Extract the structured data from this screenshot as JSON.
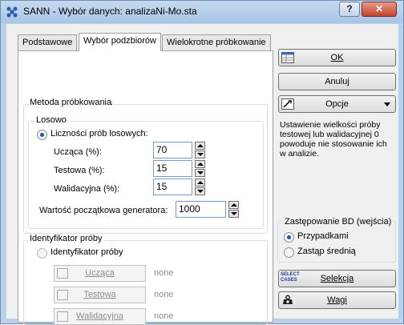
{
  "window": {
    "title": "SANN - Wybór danych: analizaNi-Mo.sta",
    "help": "?",
    "close": "✕"
  },
  "tabs": [
    "Podstawowe",
    "Wybór podzbiorów",
    "Wielokrotne próbkowanie"
  ],
  "method": {
    "group_label": "Metoda próbkowania",
    "random": {
      "group_label": "Losowo",
      "option_label": "Liczności prób losowych:",
      "fields": [
        {
          "label": "Ucząca (%):",
          "value": "70"
        },
        {
          "label": "Testowa (%):",
          "value": "15"
        },
        {
          "label": "Walidacyjna (%):",
          "value": "15"
        }
      ],
      "seed_label": "Wartość początkowa generatora:",
      "seed_value": "1000"
    },
    "identifier": {
      "group_label": "Identyfikator próby",
      "option_label": "Identyfikator próby",
      "buttons": [
        {
          "label": "Ucząca",
          "status": "none"
        },
        {
          "label": "Testowa",
          "status": "none"
        },
        {
          "label": "Walidacyjna",
          "status": "none"
        }
      ]
    }
  },
  "right": {
    "ok": "OK",
    "cancel": "Anuluj",
    "options": "Opcje",
    "note": "Ustawienie wielkości próby testowej lub walidacyjnej 0 powoduje nie stosowanie ich w analizie.",
    "replace": {
      "group_label": "Zastępowanie BD (wejścia)",
      "options": [
        "Przypadkami",
        "Zastąp średnią"
      ]
    },
    "selection": "Selekcja",
    "weights": "Wagi",
    "selection_icon_text": "SELECT CASES"
  },
  "colors": {
    "frame": "#b9d1ea",
    "face": "#f0f0f0",
    "radio_dot": "#1e56a0"
  }
}
